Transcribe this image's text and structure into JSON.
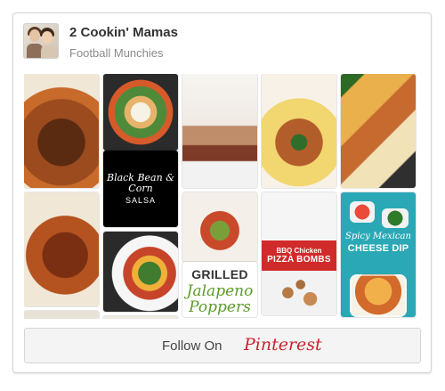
{
  "header": {
    "title": "2 Cookin' Mamas",
    "subtitle": "Football Munchies"
  },
  "pins": {
    "black_bean_line1": "Black Bean & Corn",
    "black_bean_line2": "SALSA",
    "grilled_line1": "GRILLED",
    "grilled_line2": "Jalapeno",
    "grilled_line3": "Poppers",
    "pizza_bombs_line1": "BBQ Chicken",
    "pizza_bombs_line2": "PIZZA BOMBS",
    "cheese_dip_line1": "Spicy Mexican",
    "cheese_dip_line2": "CHEESE DIP"
  },
  "footer": {
    "follow_label": "Follow On",
    "brand_label": "Pinterest"
  },
  "colors": {
    "border": "#d3d3d3",
    "muted_text": "#8a8a8a",
    "brand_red": "#c8232c",
    "footer_bg": "#f4f4f4"
  }
}
